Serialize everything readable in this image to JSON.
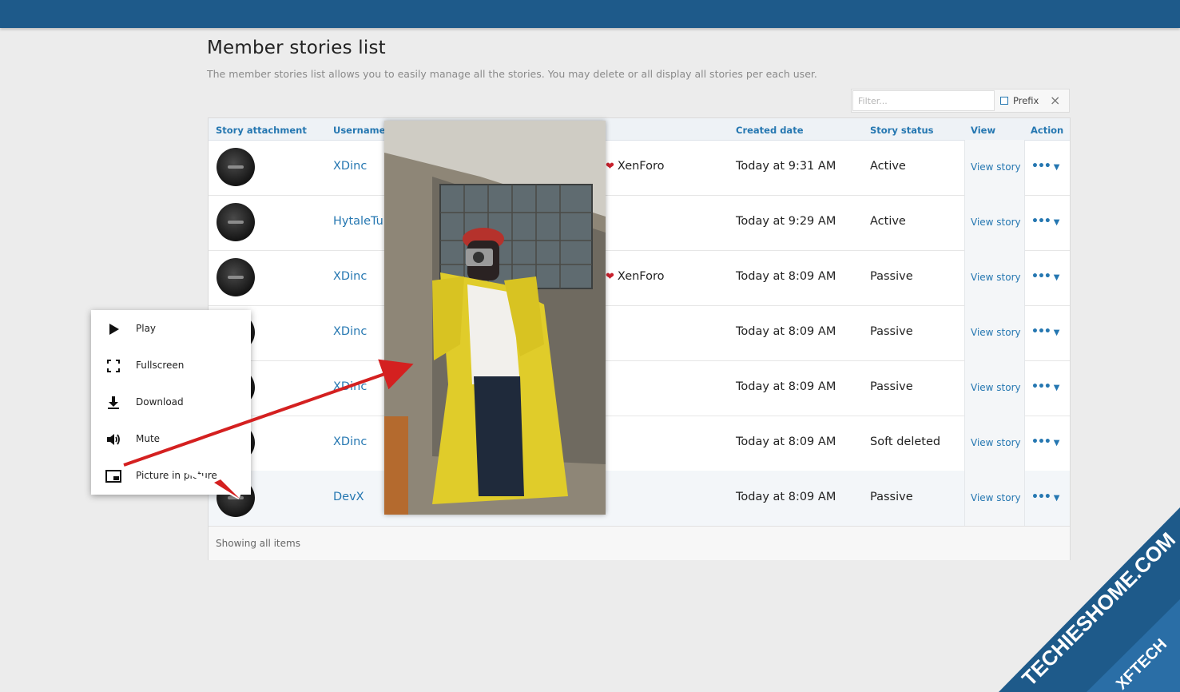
{
  "header": {
    "title": "Member stories list",
    "description": "The member stories list allows you to easily manage all the stories. You may delete or all display all stories per each user."
  },
  "filter": {
    "placeholder": "Filter...",
    "prefix_label": "Prefix",
    "clear_icon": "×"
  },
  "table": {
    "columns": {
      "attachment": "Story attachment",
      "username": "Username",
      "created": "Created date",
      "status": "Story status",
      "view": "View",
      "action": "Action"
    },
    "rows": [
      {
        "username": "XDinc",
        "forum": "XenForo",
        "created": "Today at 9:31 AM",
        "status": "Active",
        "view": "View story",
        "action": "•••"
      },
      {
        "username": "HytaleTur",
        "forum": "",
        "created": "Today at 9:29 AM",
        "status": "Active",
        "view": "View story",
        "action": "•••"
      },
      {
        "username": "XDinc",
        "forum": "XenForo",
        "created": "Today at 8:09 AM",
        "status": "Passive",
        "view": "View story",
        "action": "•••"
      },
      {
        "username": "XDinc",
        "forum": "",
        "created": "Today at 8:09 AM",
        "status": "Passive",
        "view": "View story",
        "action": "•••"
      },
      {
        "username": "XDinc",
        "forum": "",
        "created": "Today at 8:09 AM",
        "status": "Passive",
        "view": "View story",
        "action": "•••"
      },
      {
        "username": "XDinc",
        "forum": "",
        "created": "Today at 8:09 AM",
        "status": "Soft deleted",
        "view": "View story",
        "action": "•••"
      },
      {
        "username": "DevX",
        "forum": "",
        "created": "Today at 8:09 AM",
        "status": "Passive",
        "view": "View story",
        "action": "•••"
      }
    ],
    "footer": "Showing all items"
  },
  "context_menu": {
    "items": [
      {
        "label": "Play",
        "icon": "play-icon"
      },
      {
        "label": "Fullscreen",
        "icon": "fullscreen-icon"
      },
      {
        "label": "Download",
        "icon": "download-icon"
      },
      {
        "label": "Mute",
        "icon": "volume-icon"
      },
      {
        "label": "Picture in picture",
        "icon": "picture-in-picture-icon"
      }
    ]
  },
  "watermark": {
    "line1": "TECHIESHOME.COM",
    "line2": "XFTECH"
  },
  "colors": {
    "topbar": "#1e5a8a",
    "link": "#2577b1",
    "arrow": "#d42020"
  }
}
